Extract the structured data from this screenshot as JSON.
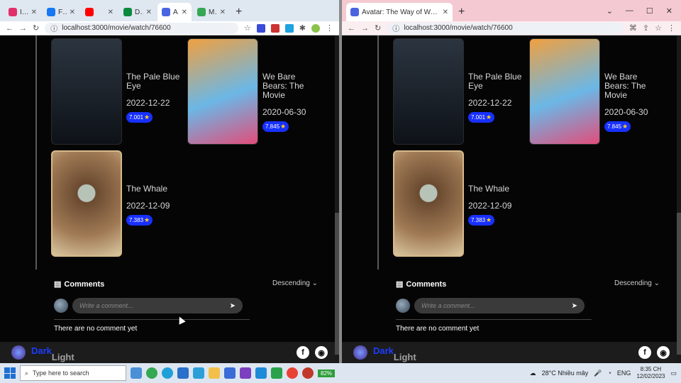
{
  "left_window": {
    "tabs": [
      {
        "label": "Ins",
        "color": "#e1306c"
      },
      {
        "label": "Fac",
        "color": "#1877f2"
      },
      {
        "label": "",
        "color": "#ff0000"
      },
      {
        "label": "Dul",
        "color": "#0b8a3e"
      },
      {
        "label": "Ava",
        "color": "#4a64e0"
      },
      {
        "label": "Mc",
        "color": "#34a853"
      }
    ],
    "active_tab_index": 4,
    "url": "localhost:3000/movie/watch/76600"
  },
  "right_window": {
    "tab_title": "Avatar: The Way of Water | Dark",
    "url": "localhost:3000/movie/watch/76600"
  },
  "movies": [
    {
      "title": "The Pale Blue Eye",
      "date": "2022-12-22",
      "rating": "7.001",
      "poster_color": "#1f2a33"
    },
    {
      "title": "We Bare Bears: The Movie",
      "date": "2020-06-30",
      "rating": "7.845",
      "poster_color": "#e08a3c"
    },
    {
      "title": "The Whale",
      "date": "2022-12-09",
      "rating": "7.383",
      "poster_color": "#8a6a4a"
    }
  ],
  "comments": {
    "title": "Comments",
    "sort": "Descending",
    "placeholder": "Write a comment...",
    "empty": "There are no comment yet"
  },
  "footer": {
    "dark_label": "Dark",
    "light_label": "Light"
  },
  "taskbar": {
    "search_placeholder": "Type here to search",
    "battery": "82%",
    "weather": "28°C  Nhiều mây",
    "lang": "ENG",
    "time": "8:35 CH",
    "date": "12/02/2023"
  }
}
